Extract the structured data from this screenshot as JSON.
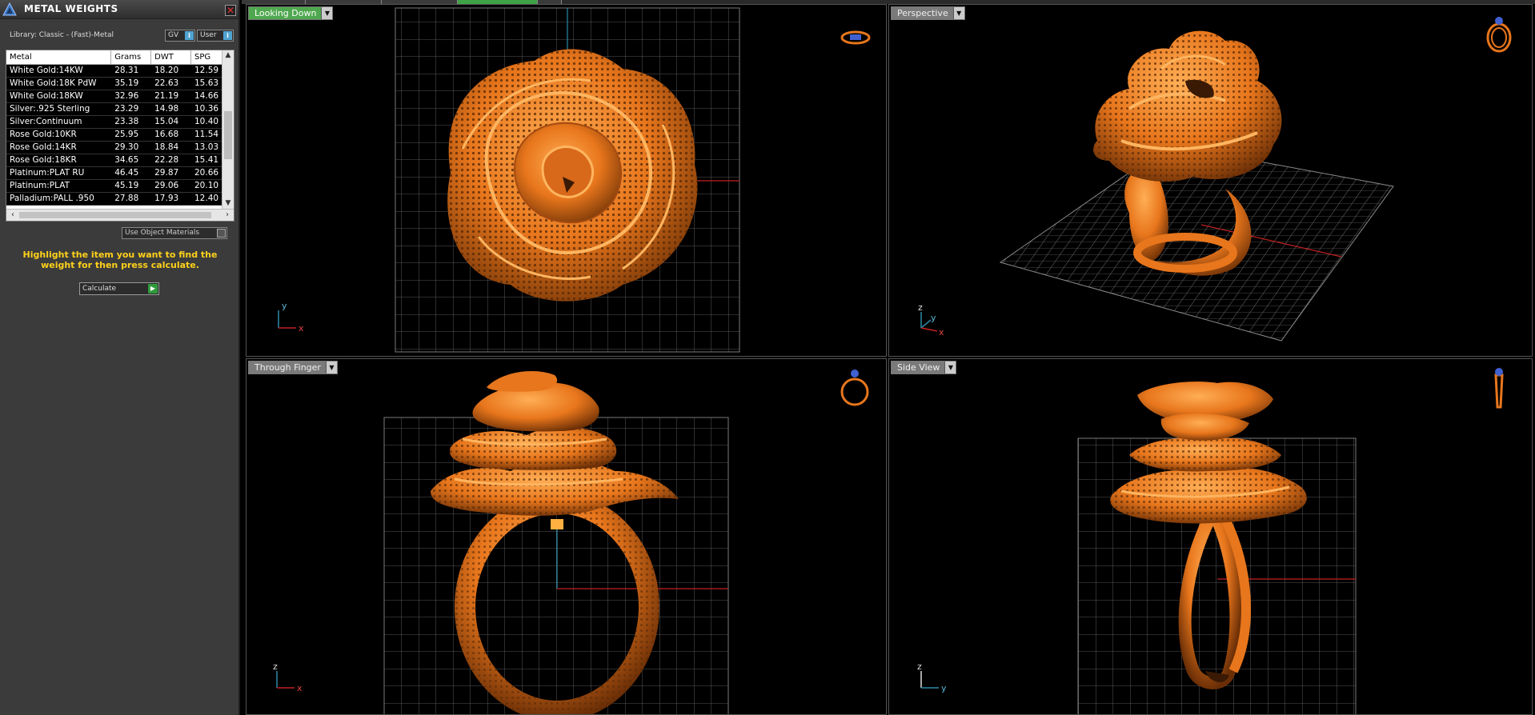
{
  "panel": {
    "title": "METAL WEIGHTS",
    "close_glyph": "✕",
    "library_label": "Library: Classic - (Fast)-Metal",
    "gv_label": "GV",
    "user_label": "User",
    "info_glyph": "i",
    "columns": [
      "Metal",
      "Grams",
      "DWT",
      "SPG"
    ],
    "rows": [
      [
        "White Gold:14KW",
        "28.31",
        "18.20",
        "12.59"
      ],
      [
        "White Gold:18K PdW",
        "35.19",
        "22.63",
        "15.63"
      ],
      [
        "White Gold:18KW",
        "32.96",
        "21.19",
        "14.66"
      ],
      [
        "Silver:.925 Sterling",
        "23.29",
        "14.98",
        "10.36"
      ],
      [
        "Silver:Continuum",
        "23.38",
        "15.04",
        "10.40"
      ],
      [
        "Rose Gold:10KR",
        "25.95",
        "16.68",
        "11.54"
      ],
      [
        "Rose Gold:14KR",
        "29.30",
        "18.84",
        "13.03"
      ],
      [
        "Rose Gold:18KR",
        "34.65",
        "22.28",
        "15.41"
      ],
      [
        "Platinum:PLAT RU",
        "46.45",
        "29.87",
        "20.66"
      ],
      [
        "Platinum:PLAT",
        "45.19",
        "29.06",
        "20.10"
      ],
      [
        "Palladium:PALL .950",
        "27.88",
        "17.93",
        "12.40"
      ]
    ],
    "use_materials_label": "Use Object Materials",
    "hint": "Highlight the item you want to find the weight for then press calculate.",
    "calculate_label": "Calculate"
  },
  "viewports": {
    "top": {
      "label": "Looking Down",
      "axis_a": "y",
      "axis_b": "x"
    },
    "perspective": {
      "label": "Perspective",
      "axis_a": "z",
      "axis_b": "y",
      "axis_c": "x"
    },
    "finger": {
      "label": "Through Finger",
      "axis_a": "z",
      "axis_b": "x"
    },
    "side": {
      "label": "Side View",
      "axis_a": "z",
      "axis_b": "y"
    }
  },
  "colors": {
    "metal": "#e8761c",
    "grid": "#6e6e6e",
    "active_tab": "#3ea344",
    "hint": "#ffd11a"
  },
  "icons": [
    "app-logo-icon",
    "close-icon",
    "info-icon",
    "scroll-up-icon",
    "scroll-down-icon",
    "scroll-left-icon",
    "scroll-right-icon",
    "checkbox-icon",
    "play-icon",
    "dropdown-icon",
    "ring-icon",
    "axis-icon"
  ]
}
